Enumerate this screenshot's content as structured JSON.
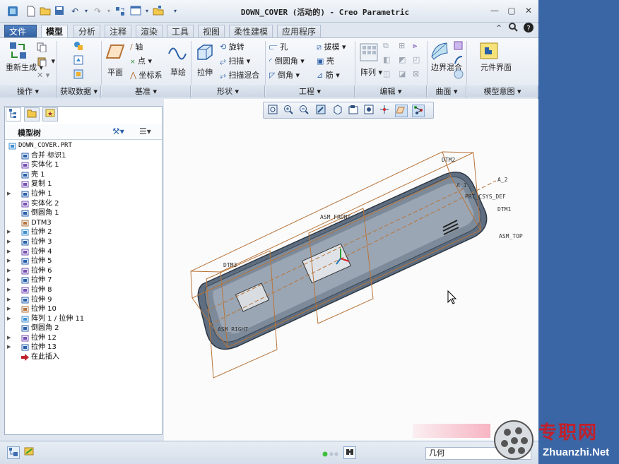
{
  "title": "DOWN_COVER (活动的) - Creo Parametric",
  "tabs": [
    "文件",
    "模型",
    "分析",
    "注释",
    "渲染",
    "工具",
    "视图",
    "柔性建模",
    "应用程序"
  ],
  "active_tab": "模型",
  "ribbon": {
    "groups": [
      "操作",
      "获取数据",
      "基准",
      "形状",
      "工程",
      "编辑",
      "曲面",
      "模型意图"
    ],
    "regenerate": "重新生成",
    "plane": "平面",
    "axis": "轴",
    "point": "点",
    "csys": "坐标系",
    "sketch": "草绘",
    "extrude": "拉伸",
    "revolve": "旋转",
    "sweep": "扫描",
    "swept_blend": "扫描混合",
    "hole": "孔",
    "round": "倒圆角",
    "chamfer": "倒角",
    "draft": "拔模",
    "shell": "壳",
    "rib": "筋",
    "pattern": "阵列",
    "boundary_blend": "边界混合",
    "component_interface": "元件界面"
  },
  "model_tree": {
    "header": "模型树",
    "items": [
      {
        "label": "DOWN_COVER.PRT",
        "expandable": false
      },
      {
        "label": "合并 标识1",
        "expandable": false
      },
      {
        "label": "实体化 1",
        "expandable": false
      },
      {
        "label": "壳 1",
        "expandable": false
      },
      {
        "label": "复制 1",
        "expandable": false
      },
      {
        "label": "拉伸 1",
        "expandable": true
      },
      {
        "label": "实体化 2",
        "expandable": false
      },
      {
        "label": "倒圆角 1",
        "expandable": false
      },
      {
        "label": "DTM3",
        "expandable": false
      },
      {
        "label": "拉伸 2",
        "expandable": true
      },
      {
        "label": "拉伸 3",
        "expandable": true
      },
      {
        "label": "拉伸 4",
        "expandable": true
      },
      {
        "label": "拉伸 5",
        "expandable": true
      },
      {
        "label": "拉伸 6",
        "expandable": true
      },
      {
        "label": "拉伸 7",
        "expandable": true
      },
      {
        "label": "拉伸 8",
        "expandable": true
      },
      {
        "label": "拉伸 9",
        "expandable": true
      },
      {
        "label": "拉伸 10",
        "expandable": true
      },
      {
        "label": "阵列 1 / 拉伸 11",
        "expandable": true
      },
      {
        "label": "倒圆角 2",
        "expandable": false
      },
      {
        "label": "拉伸 12",
        "expandable": true
      },
      {
        "label": "拉伸 13",
        "expandable": true
      },
      {
        "label": "在此插入",
        "expandable": false
      }
    ]
  },
  "datum_labels": {
    "dtm2": "DTM2",
    "a2": "A_2",
    "a1": "A_1",
    "dtm1": "DTM1",
    "csys": "PRT_CSYS_DEF",
    "asm_front": "ASM_FRONT",
    "asm_top": "ASM_TOP",
    "dtm3": "DTM3",
    "asm_right": "ASM_RIGHT"
  },
  "status": {
    "filter_value": "几何"
  },
  "watermark": {
    "title": "专职网",
    "url": "Zhuanzhi.Net"
  },
  "colors": {
    "ribbon_bg": "#e3e9f1",
    "file_tab": "#35629f",
    "datum": "#b8753a",
    "model": "#5e6e80"
  }
}
